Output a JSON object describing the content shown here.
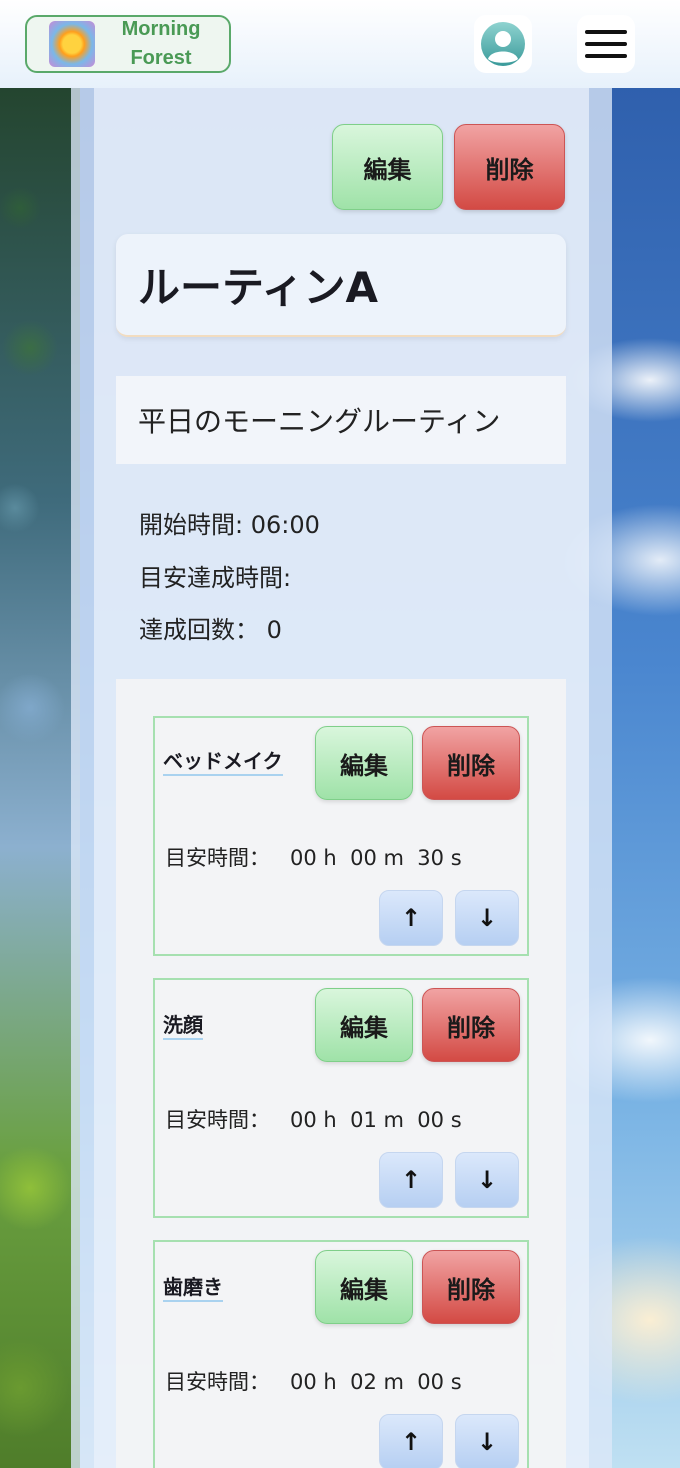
{
  "header": {
    "logo_line1": "Morning",
    "logo_line2": "Forest"
  },
  "routine": {
    "edit_label": "編集",
    "delete_label": "削除",
    "title": "ルーティンA",
    "description": "平日のモーニングルーティン",
    "start_time": "開始時間: 06:00",
    "target_time": "目安達成時間:",
    "achievement_count": "達成回数： 0"
  },
  "steps": [
    {
      "name": "ベッドメイク",
      "edit_label": "編集",
      "delete_label": "削除",
      "time_label": "目安時間：",
      "time_value": "00 h  00 m  30 s",
      "up": "↑",
      "down": "↓"
    },
    {
      "name": "洗顔",
      "edit_label": "編集",
      "delete_label": "削除",
      "time_label": "目安時間：",
      "time_value": "00 h  01 m  00 s",
      "up": "↑",
      "down": "↓"
    },
    {
      "name": "歯磨き",
      "edit_label": "編集",
      "delete_label": "削除",
      "time_label": "目安時間：",
      "time_value": "00 h  02 m  00 s",
      "up": "↑",
      "down": "↓"
    }
  ],
  "icons": {
    "logo": "sun-logo-icon",
    "avatar": "user-avatar-icon",
    "menu": "hamburger-menu-icon",
    "up": "arrow-up-icon",
    "down": "arrow-down-icon"
  }
}
